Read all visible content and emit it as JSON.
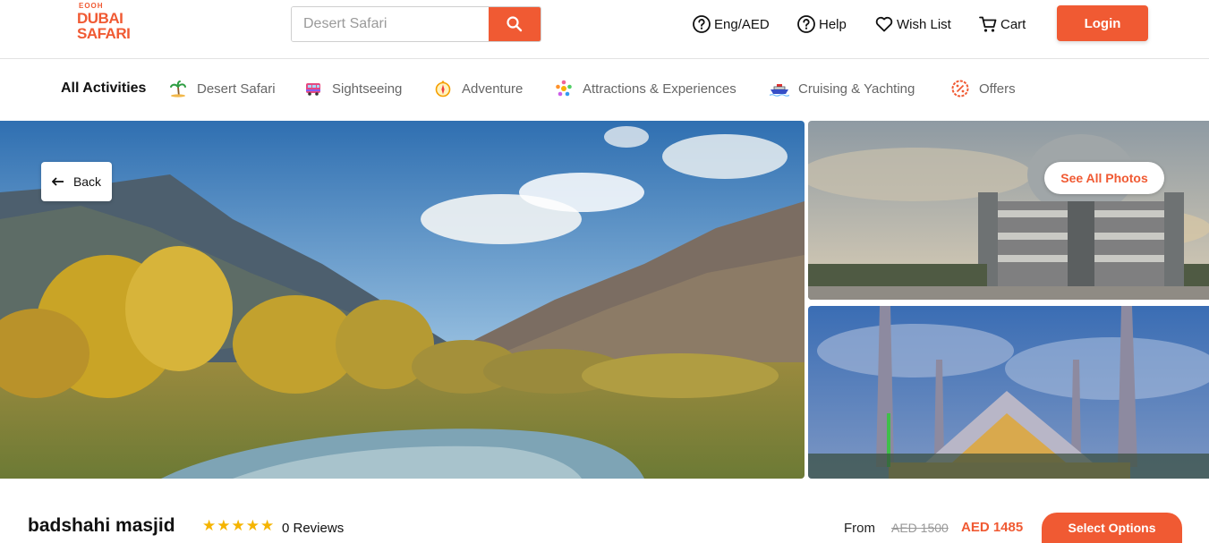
{
  "brand": {
    "logo_small": "EOOH",
    "logo_line1": "DUBAI",
    "logo_line2": "SAFARI",
    "accent_color": "#f05a33"
  },
  "search": {
    "placeholder": "Desert Safari",
    "icon": "search-icon"
  },
  "header_nav": [
    {
      "label": "Eng/AED",
      "icon": "help-circle-icon"
    },
    {
      "label": "Help",
      "icon": "help-circle-icon"
    },
    {
      "label": "Wish List",
      "icon": "heart-icon"
    },
    {
      "label": "Cart",
      "icon": "cart-icon"
    }
  ],
  "login_label": "Login",
  "categories": {
    "all_label": "All Activities",
    "items": [
      {
        "label": "Desert Safari",
        "icon": "palm-tree-icon"
      },
      {
        "label": "Sightseeing",
        "icon": "bus-icon"
      },
      {
        "label": "Adventure",
        "icon": "compass-icon"
      },
      {
        "label": "Attractions & Experiences",
        "icon": "ferris-wheel-icon"
      },
      {
        "label": "Cruising & Yachting",
        "icon": "ship-icon"
      },
      {
        "label": "Offers",
        "icon": "percent-badge-icon"
      }
    ]
  },
  "gallery": {
    "back_label": "Back",
    "see_all_label": "See All Photos"
  },
  "listing": {
    "title": "badshahi masjid",
    "stars": "★★★★★",
    "reviews": "0 Reviews",
    "from_label": "From",
    "old_price": "AED 1500",
    "new_price": "AED 1485",
    "select_label": "Select Options"
  }
}
